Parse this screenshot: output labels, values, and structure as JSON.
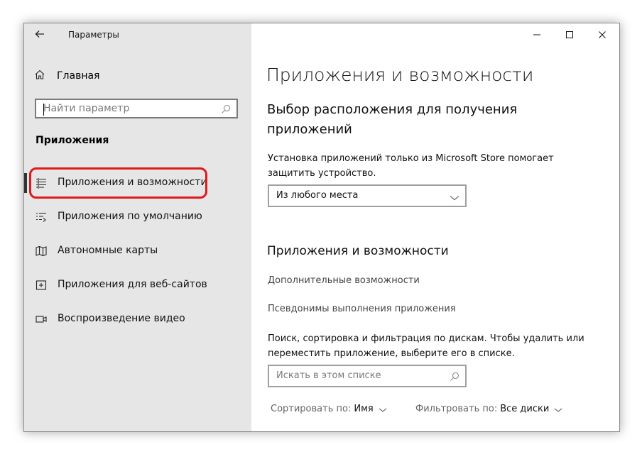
{
  "window": {
    "title": "Параметры",
    "back_icon": "back-arrow-icon",
    "controls": [
      "minimize-icon",
      "maximize-icon",
      "close-icon"
    ]
  },
  "sidebar": {
    "home_label": "Главная",
    "search_placeholder": "Найти параметр",
    "section_title": "Приложения",
    "items": [
      {
        "label": "Приложения и возможности",
        "icon": "list-icon",
        "active": true
      },
      {
        "label": "Приложения по умолчанию",
        "icon": "default-apps-icon",
        "active": false
      },
      {
        "label": "Автономные карты",
        "icon": "map-icon",
        "active": false
      },
      {
        "label": "Приложения для веб-сайтов",
        "icon": "web-app-icon",
        "active": false
      },
      {
        "label": "Воспроизведение видео",
        "icon": "video-icon",
        "active": false
      }
    ],
    "highlight_color": "#e0191b"
  },
  "main": {
    "title": "Приложения и возможности",
    "location_heading": "Выбор расположения для получения приложений",
    "location_desc": "Установка приложений только из Microsoft Store помогает защитить устройство.",
    "location_dropdown_value": "Из любого места",
    "apps_heading": "Приложения и возможности",
    "link_optional": "Дополнительные возможности",
    "link_aliases": "Псевдонимы выполнения приложения",
    "apps_desc": "Поиск, сортировка и фильтрация по дискам. Чтобы удалить или переместить приложение, выберите его в списке.",
    "list_search_placeholder": "Искать в этом списке",
    "sort_label": "Сортировать по:",
    "sort_value": "Имя",
    "filter_label": "Фильтровать по:",
    "filter_value": "Все диски"
  }
}
